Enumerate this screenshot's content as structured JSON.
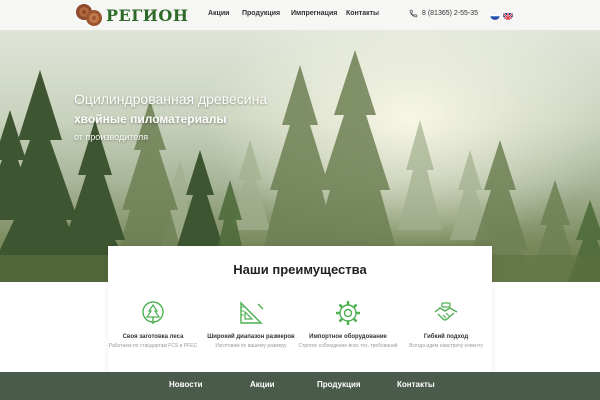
{
  "header": {
    "logo_text": "РЕГИОН",
    "nav": [
      "Акции",
      "Продукция",
      "Импрегнация",
      "Контакты"
    ],
    "phone": "8 (81365) 2-55-35",
    "languages": [
      "ru",
      "en"
    ]
  },
  "hero": {
    "line1": "Оцилиндрованная древесина",
    "line2": "хвойные пиломатериалы",
    "line3": "от производителя"
  },
  "advantages": {
    "heading": "Наши преимущества",
    "items": [
      {
        "title": "Своя заготовка леса",
        "desc": "Работаем по стандартам FCS и PFEC",
        "icon": "tree-icon"
      },
      {
        "title": "Широкий диапазон размеров",
        "desc": "Изготовим по вашему размеру",
        "icon": "triangle-ruler-icon"
      },
      {
        "title": "Импортное оборудование",
        "desc": "Строгое соблюдение всех тех. требований",
        "icon": "gear-icon"
      },
      {
        "title": "Гибкий подход",
        "desc": "Всегда идем навстречу клиенту",
        "icon": "handshake-icon"
      }
    ]
  },
  "footer": {
    "nav": [
      "Новости",
      "Акции",
      "Продукция",
      "Контакты"
    ]
  },
  "colors": {
    "brand_green": "#2e6b2a",
    "icon_green": "#4caf50",
    "footer_bg": "#4a5b4c"
  }
}
